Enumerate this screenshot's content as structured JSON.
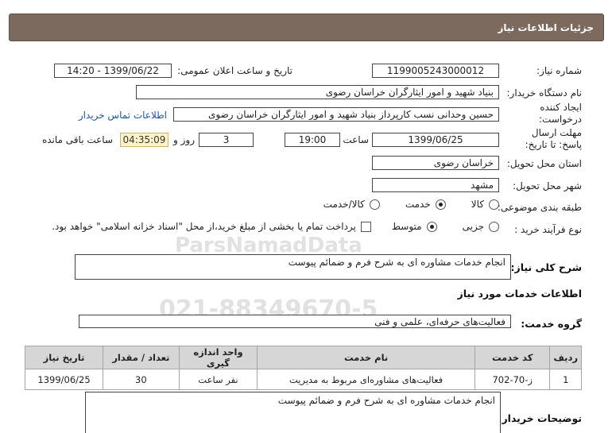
{
  "header": {
    "title": "جزئیات اطلاعات نیاز"
  },
  "fields": {
    "need_number_label": "شماره نیاز:",
    "need_number": "1199005243000012",
    "announce_label": "تاریخ و ساعت اعلان عمومی:",
    "announce_value": "1399/06/22 - 14:20",
    "buyer_label": "نام دستگاه خریدار:",
    "buyer_value": "بنیاد شهید و امور ایثارگران خراسان رضوی",
    "creator_label": "ایجاد کننده درخواست:",
    "creator_value": "حسین وحدانی نسب کارپرداز بنیاد شهید و امور ایثارگران خراسان رضوی",
    "contact_link": "اطلاعات تماس خریدار",
    "deadline_label": "مهلت ارسال پاسخ: تا تاریخ:",
    "deadline_date": "1399/06/25",
    "time_label": "ساعت",
    "deadline_time": "19:00",
    "days_value": "3",
    "days_label": "روز و",
    "remaining_time": "04:35:09",
    "remaining_label": "ساعت باقی مانده",
    "province_label": "استان محل تحویل:",
    "province_value": "خراسان رضوی",
    "city_label": "شهر محل تحویل:",
    "city_value": "مشهد",
    "category_label": "طبقه بندی موضوعی:",
    "category_options": [
      "کالا",
      "خدمت",
      "کالا/خدمت"
    ],
    "category_selected": "خدمت",
    "process_label": "نوع فرآیند خرید :",
    "process_options": [
      "جزیی",
      "متوسط"
    ],
    "process_selected": "متوسط",
    "payment_note": "پرداخت تمام یا بخشی از مبلغ خرید،از محل \"اسناد خزانه اسلامی\" خواهد بود."
  },
  "summary": {
    "label": "شرح کلی نیاز:",
    "value": "انجام خدمات مشاوره ای به شرح فرم و ضمائم پیوست"
  },
  "services_section": {
    "title": "اطلاعات خدمات مورد نیاز"
  },
  "service_group": {
    "label": "گروه خدمت:",
    "value": "فعالیت‌های حرفه‌ای، علمی و فنی"
  },
  "table": {
    "headers": [
      "ردیف",
      "کد خدمت",
      "نام خدمت",
      "واحد اندازه گیری",
      "تعداد / مقدار",
      "تاریخ نیاز"
    ],
    "rows": [
      [
        "1",
        "ز-70-702",
        "فعالیت‌های مشاوره‌ای مربوط به مدیریت",
        "نفر ساعت",
        "30",
        "1399/06/25"
      ]
    ]
  },
  "buyer_notes": {
    "label": "توضیحات خریدار:",
    "value": "انجام خدمات مشاوره ای به شرح فرم و ضمائم پیوست"
  },
  "colors": {
    "header_bg": "#7d6a5e",
    "timer_bg": "#fdf3c6",
    "table_header_bg": "#d6d6d6",
    "link": "#1a55a8"
  }
}
